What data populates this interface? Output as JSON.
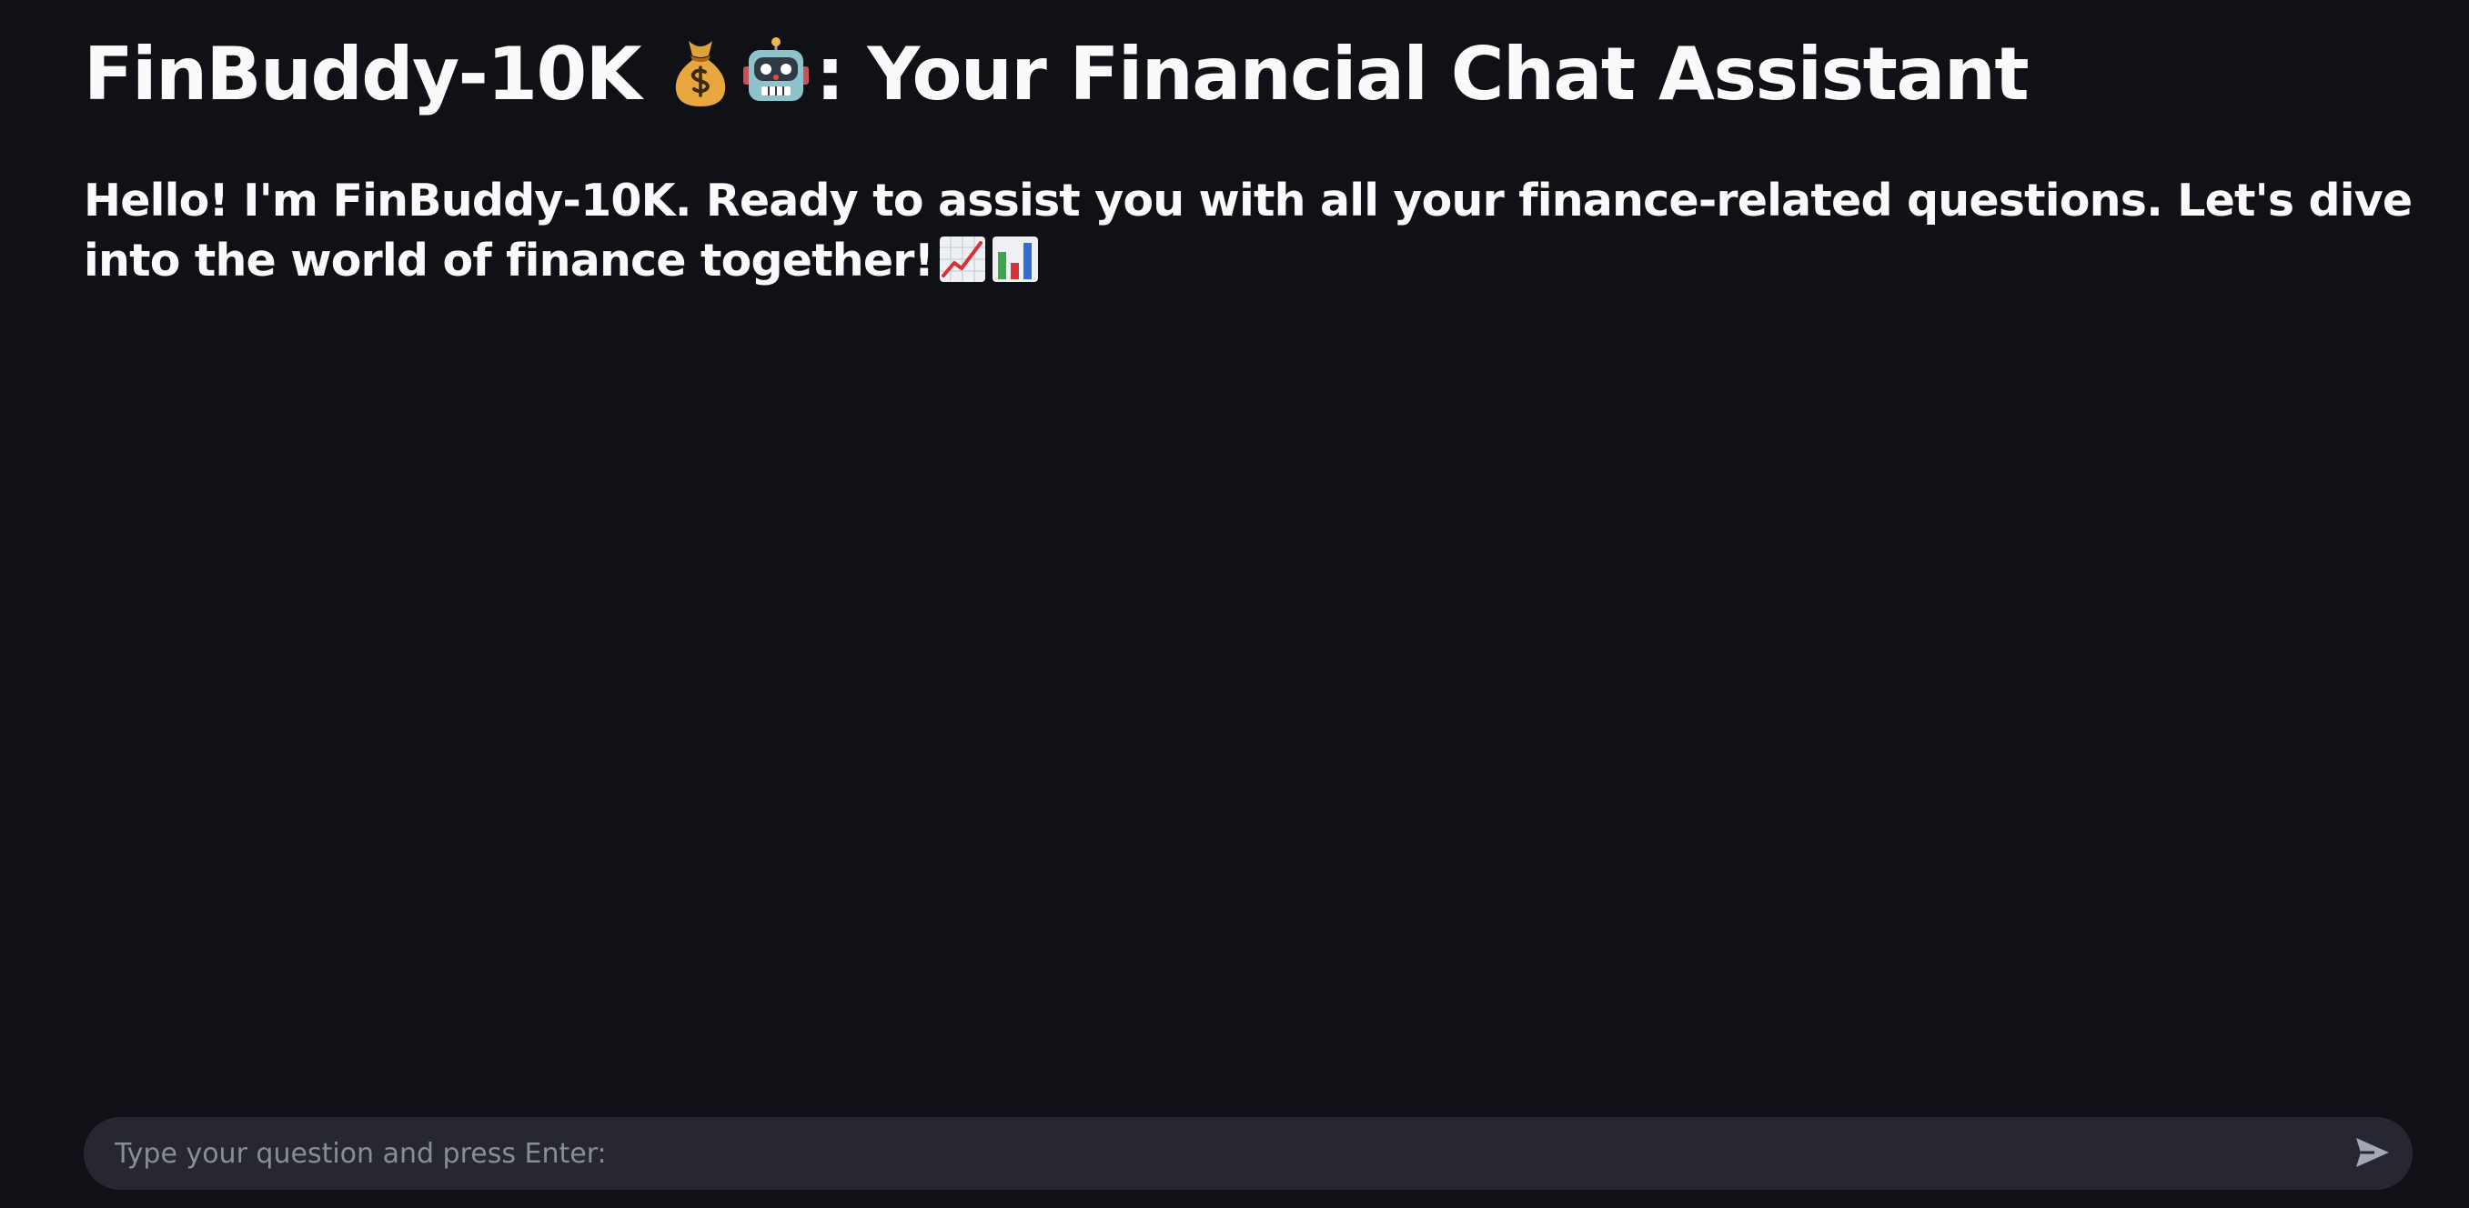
{
  "header": {
    "title_prefix": "FinBuddy-10K",
    "title_suffix": ": Your Financial Chat Assistant",
    "title_icons": [
      "money-bag-icon",
      "robot-icon"
    ]
  },
  "message": {
    "text": "Hello! I'm FinBuddy-10K. Ready to assist you with all your finance-related questions. Let's dive into the world of finance together!",
    "icons": [
      "chart-increasing-icon",
      "bar-chart-icon"
    ]
  },
  "chat_input": {
    "placeholder": "Type your question and press Enter:",
    "value": "",
    "send_icon": "send-icon"
  },
  "colors": {
    "background": "#0f1116",
    "text": "#fafafa",
    "input_background": "#262730",
    "placeholder": "#8b8d96"
  }
}
